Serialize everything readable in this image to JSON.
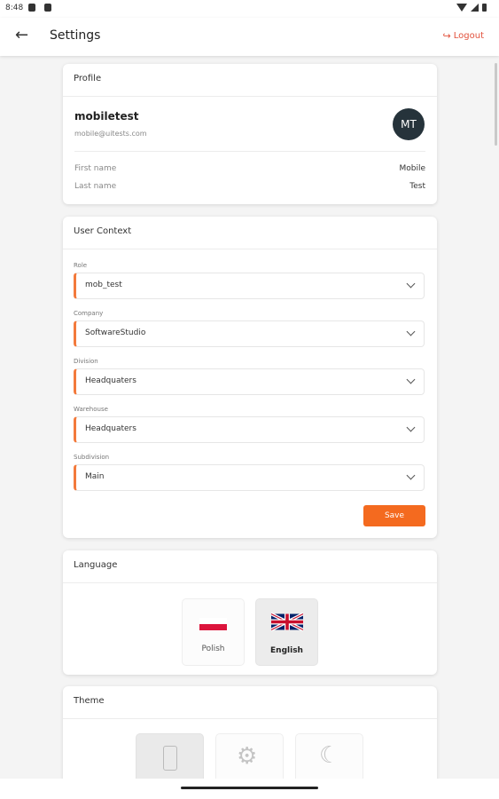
{
  "status": {
    "time": "8:48"
  },
  "appbar": {
    "title": "Settings",
    "logout_label": "Logout"
  },
  "profile": {
    "heading": "Profile",
    "username": "mobiletest",
    "email": "mobile@uitests.com",
    "initials": "MT",
    "first_name_label": "First name",
    "first_name": "Mobile",
    "last_name_label": "Last name",
    "last_name": "Test"
  },
  "context": {
    "heading": "User Context",
    "fields": [
      {
        "label": "Role",
        "value": "mob_test"
      },
      {
        "label": "Company",
        "value": "SoftwareStudio"
      },
      {
        "label": "Division",
        "value": "Headquaters"
      },
      {
        "label": "Warehouse",
        "value": "Headquaters"
      },
      {
        "label": "Subdivision",
        "value": "Main"
      }
    ],
    "save_label": "Save"
  },
  "language": {
    "heading": "Language",
    "options": [
      {
        "label": "Polish",
        "selected": false
      },
      {
        "label": "English",
        "selected": true
      }
    ]
  },
  "theme": {
    "heading": "Theme",
    "options": [
      {
        "icon": "phone-icon",
        "selected": true
      },
      {
        "icon": "gear-icon",
        "selected": false
      },
      {
        "icon": "moon-icon",
        "selected": false
      }
    ]
  },
  "colors": {
    "accent": "#f46a1f",
    "logout": "#e2513c",
    "avatar": "#26333b"
  }
}
